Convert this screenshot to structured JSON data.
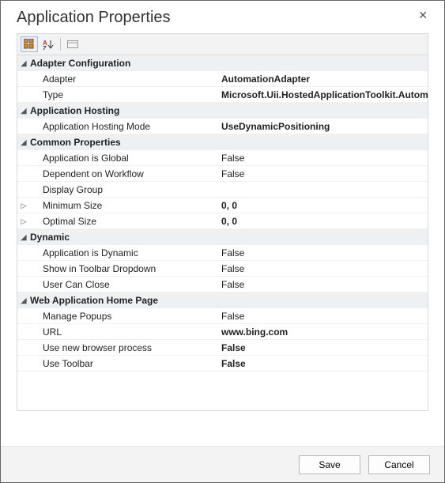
{
  "title": "Application Properties",
  "toolbar": {
    "mode_categorized": "categorized-view",
    "mode_alpha": "alphabetical-view",
    "mode_pages": "property-pages-view"
  },
  "buttons": {
    "save": "Save",
    "cancel": "Cancel"
  },
  "expand_glyph": "◢",
  "collapse_glyph": "▷",
  "categories": [
    {
      "name": "Adapter Configuration",
      "expanded": true,
      "props": [
        {
          "label": "Adapter",
          "value": "AutomationAdapter",
          "bold": true
        },
        {
          "label": "Type",
          "value": "Microsoft.Uii.HostedApplicationToolkit.AutomationAdapter",
          "bold": true
        }
      ]
    },
    {
      "name": "Application Hosting",
      "expanded": true,
      "props": [
        {
          "label": "Application Hosting Mode",
          "value": "UseDynamicPositioning",
          "bold": true
        }
      ]
    },
    {
      "name": "Common Properties",
      "expanded": true,
      "props": [
        {
          "label": "Application is Global",
          "value": "False"
        },
        {
          "label": "Dependent on Workflow",
          "value": "False"
        },
        {
          "label": "Display Group",
          "value": ""
        },
        {
          "label": "Minimum Size",
          "value": "0, 0",
          "expander": "closed",
          "bold": true
        },
        {
          "label": "Optimal Size",
          "value": "0, 0",
          "expander": "closed",
          "bold": true
        }
      ]
    },
    {
      "name": "Dynamic",
      "expanded": true,
      "props": [
        {
          "label": "Application is Dynamic",
          "value": "False"
        },
        {
          "label": "Show in Toolbar Dropdown",
          "value": "False"
        },
        {
          "label": "User Can Close",
          "value": "False"
        }
      ]
    },
    {
      "name": "Web Application Home Page",
      "expanded": true,
      "props": [
        {
          "label": "Manage Popups",
          "value": "False"
        },
        {
          "label": "URL",
          "value": "www.bing.com",
          "bold": true
        },
        {
          "label": "Use new browser process",
          "value": "False",
          "bold": true
        },
        {
          "label": "Use Toolbar",
          "value": "False",
          "bold": true
        }
      ]
    }
  ]
}
